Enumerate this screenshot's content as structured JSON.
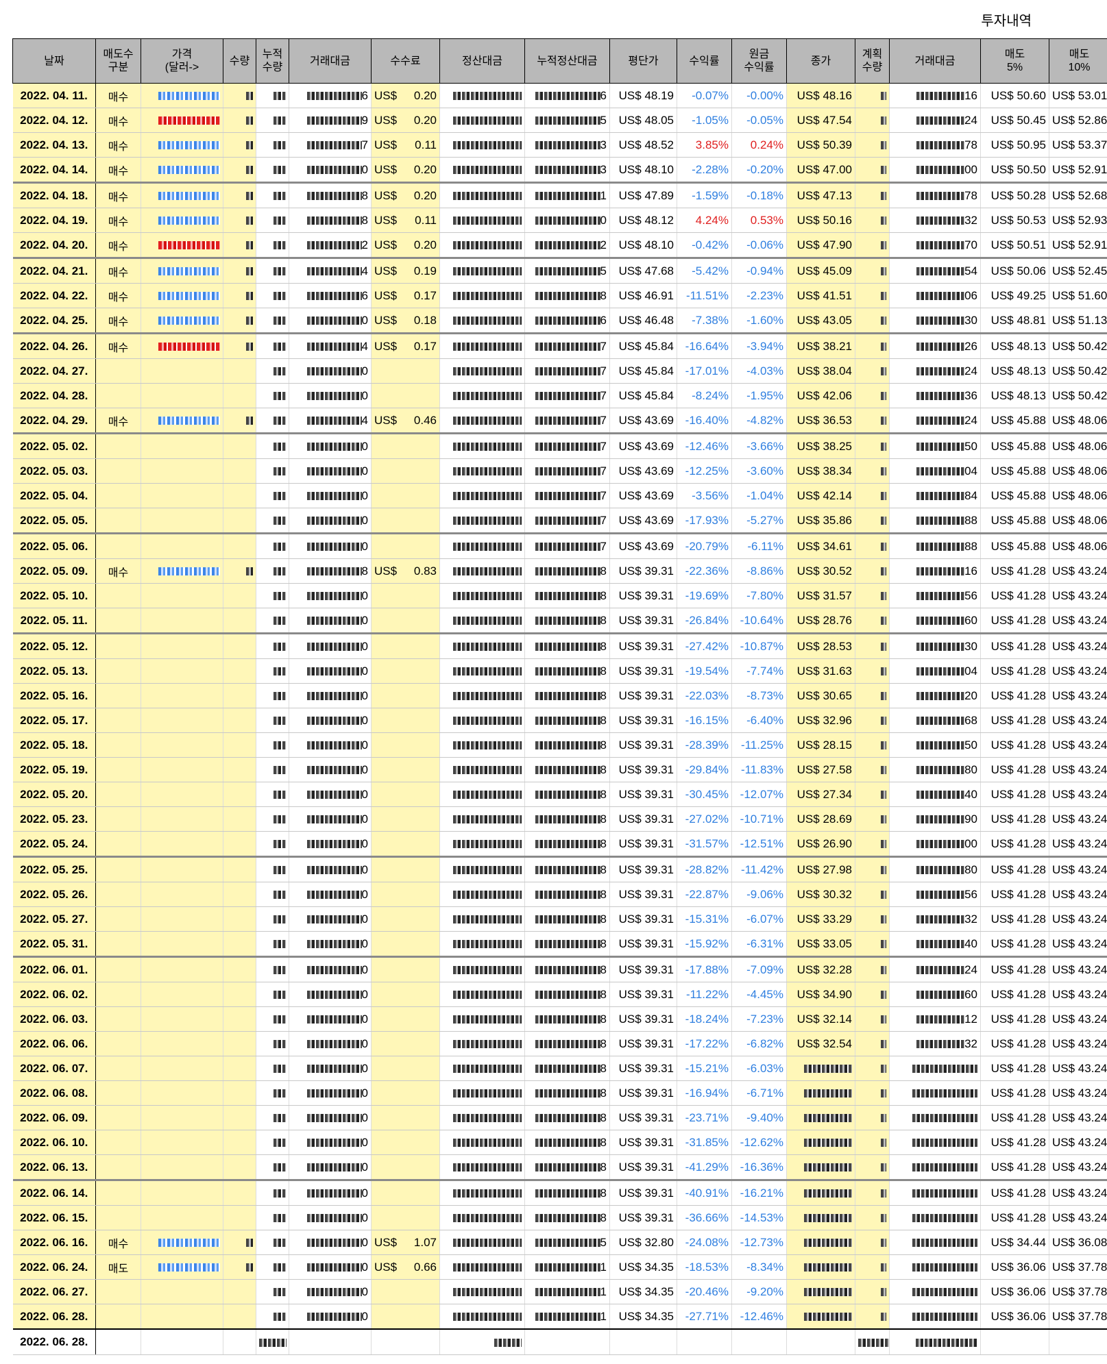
{
  "title": "투자내역",
  "headers": [
    "날짜",
    "매도수\n구분",
    "가격\n(달러->",
    "수량",
    "누적\n수량",
    "거래대금",
    "수수료",
    "정산대금",
    "누적정산대금",
    "평단가",
    "수익률",
    "원금\n수익률",
    "종가",
    "계획\n수량",
    "거래대금",
    "매도\n5%",
    "매도\n10%"
  ],
  "rows": [
    {
      "date": "2022. 04. 11.",
      "kind": "매수",
      "price_style": "blue",
      "fee": "0.20",
      "amt_tail": "6",
      "cum_tail": "6",
      "avg": "US$ 48.19",
      "ret": "-0.07%",
      "pret": "-0.00%",
      "close": "US$ 48.16",
      "amt2_tail": "16",
      "s5": "US$ 50.60",
      "s10": "US$ 53.01"
    },
    {
      "date": "2022. 04. 12.",
      "kind": "매수",
      "price_style": "red",
      "fee": "0.20",
      "amt_tail": "9",
      "cum_tail": "5",
      "avg": "US$ 48.05",
      "ret": "-1.05%",
      "pret": "-0.05%",
      "close": "US$ 47.54",
      "amt2_tail": "24",
      "s5": "US$ 50.45",
      "s10": "US$ 52.86"
    },
    {
      "date": "2022. 04. 13.",
      "kind": "매수",
      "price_style": "blue",
      "fee": "0.11",
      "amt_tail": "7",
      "cum_tail": "3",
      "avg": "US$ 48.52",
      "ret": "3.85%",
      "pret": "0.24%",
      "close": "US$ 50.39",
      "amt2_tail": "78",
      "s5": "US$ 50.95",
      "s10": "US$ 53.37"
    },
    {
      "date": "2022. 04. 14.",
      "kind": "매수",
      "price_style": "blue",
      "fee": "0.20",
      "amt_tail": "0",
      "cum_tail": "3",
      "avg": "US$ 48.10",
      "ret": "-2.28%",
      "pret": "-0.20%",
      "close": "US$ 47.00",
      "amt2_tail": "00",
      "s5": "US$ 50.50",
      "s10": "US$ 52.91"
    },
    {
      "date": "2022. 04. 18.",
      "kind": "매수",
      "price_style": "blue",
      "fee": "0.20",
      "amt_tail": "8",
      "cum_tail": "1",
      "avg": "US$ 47.89",
      "ret": "-1.59%",
      "pret": "-0.18%",
      "close": "US$ 47.13",
      "amt2_tail": "78",
      "s5": "US$ 50.28",
      "s10": "US$ 52.68",
      "sep": true
    },
    {
      "date": "2022. 04. 19.",
      "kind": "매수",
      "price_style": "blue",
      "fee": "0.11",
      "amt_tail": "8",
      "cum_tail": "0",
      "avg": "US$ 48.12",
      "ret": "4.24%",
      "pret": "0.53%",
      "close": "US$ 50.16",
      "amt2_tail": "32",
      "s5": "US$ 50.53",
      "s10": "US$ 52.93"
    },
    {
      "date": "2022. 04. 20.",
      "kind": "매수",
      "price_style": "red",
      "fee": "0.20",
      "amt_tail": "2",
      "cum_tail": "2",
      "avg": "US$ 48.10",
      "ret": "-0.42%",
      "pret": "-0.06%",
      "close": "US$ 47.90",
      "amt2_tail": "70",
      "s5": "US$ 50.51",
      "s10": "US$ 52.91"
    },
    {
      "date": "2022. 04. 21.",
      "kind": "매수",
      "price_style": "blue",
      "fee": "0.19",
      "amt_tail": "4",
      "cum_tail": "5",
      "avg": "US$ 47.68",
      "ret": "-5.42%",
      "pret": "-0.94%",
      "close": "US$ 45.09",
      "amt2_tail": "54",
      "s5": "US$ 50.06",
      "s10": "US$ 52.45",
      "sep": true
    },
    {
      "date": "2022. 04. 22.",
      "kind": "매수",
      "price_style": "blue",
      "fee": "0.17",
      "amt_tail": "6",
      "cum_tail": "8",
      "avg": "US$ 46.91",
      "ret": "-11.51%",
      "pret": "-2.23%",
      "close": "US$ 41.51",
      "amt2_tail": "06",
      "s5": "US$ 49.25",
      "s10": "US$ 51.60"
    },
    {
      "date": "2022. 04. 25.",
      "kind": "매수",
      "price_style": "blue",
      "fee": "0.18",
      "amt_tail": "0",
      "cum_tail": "6",
      "avg": "US$ 46.48",
      "ret": "-7.38%",
      "pret": "-1.60%",
      "close": "US$ 43.05",
      "amt2_tail": "30",
      "s5": "US$ 48.81",
      "s10": "US$ 51.13"
    },
    {
      "date": "2022. 04. 26.",
      "kind": "매수",
      "price_style": "red",
      "fee": "0.17",
      "amt_tail": "4",
      "cum_tail": "7",
      "avg": "US$ 45.84",
      "ret": "-16.64%",
      "pret": "-3.94%",
      "close": "US$ 38.21",
      "amt2_tail": "26",
      "s5": "US$ 48.13",
      "s10": "US$ 50.42",
      "sep": true
    },
    {
      "date": "2022. 04. 27.",
      "kind": "",
      "price_style": "",
      "fee": "",
      "amt_tail": "0",
      "cum_tail": "7",
      "avg": "US$ 45.84",
      "ret": "-17.01%",
      "pret": "-4.03%",
      "close": "US$ 38.04",
      "amt2_tail": "24",
      "s5": "US$ 48.13",
      "s10": "US$ 50.42"
    },
    {
      "date": "2022. 04. 28.",
      "kind": "",
      "price_style": "",
      "fee": "",
      "amt_tail": "0",
      "cum_tail": "7",
      "avg": "US$ 45.84",
      "ret": "-8.24%",
      "pret": "-1.95%",
      "close": "US$ 42.06",
      "amt2_tail": "36",
      "s5": "US$ 48.13",
      "s10": "US$ 50.42"
    },
    {
      "date": "2022. 04. 29.",
      "kind": "매수",
      "price_style": "blue",
      "fee": "0.46",
      "amt_tail": "4",
      "cum_tail": "7",
      "avg": "US$ 43.69",
      "ret": "-16.40%",
      "pret": "-4.82%",
      "close": "US$ 36.53",
      "amt2_tail": "24",
      "s5": "US$ 45.88",
      "s10": "US$ 48.06"
    },
    {
      "date": "2022. 05. 02.",
      "kind": "",
      "price_style": "",
      "fee": "",
      "amt_tail": "0",
      "cum_tail": "7",
      "avg": "US$ 43.69",
      "ret": "-12.46%",
      "pret": "-3.66%",
      "close": "US$ 38.25",
      "amt2_tail": "50",
      "s5": "US$ 45.88",
      "s10": "US$ 48.06",
      "sep": true
    },
    {
      "date": "2022. 05. 03.",
      "kind": "",
      "price_style": "",
      "fee": "",
      "amt_tail": "0",
      "cum_tail": "7",
      "avg": "US$ 43.69",
      "ret": "-12.25%",
      "pret": "-3.60%",
      "close": "US$ 38.34",
      "amt2_tail": "04",
      "s5": "US$ 45.88",
      "s10": "US$ 48.06"
    },
    {
      "date": "2022. 05. 04.",
      "kind": "",
      "price_style": "",
      "fee": "",
      "amt_tail": "0",
      "cum_tail": "7",
      "avg": "US$ 43.69",
      "ret": "-3.56%",
      "pret": "-1.04%",
      "close": "US$ 42.14",
      "amt2_tail": "84",
      "s5": "US$ 45.88",
      "s10": "US$ 48.06"
    },
    {
      "date": "2022. 05. 05.",
      "kind": "",
      "price_style": "",
      "fee": "",
      "amt_tail": "0",
      "cum_tail": "7",
      "avg": "US$ 43.69",
      "ret": "-17.93%",
      "pret": "-5.27%",
      "close": "US$ 35.86",
      "amt2_tail": "88",
      "s5": "US$ 45.88",
      "s10": "US$ 48.06"
    },
    {
      "date": "2022. 05. 06.",
      "kind": "",
      "price_style": "",
      "fee": "",
      "amt_tail": "0",
      "cum_tail": "7",
      "avg": "US$ 43.69",
      "ret": "-20.79%",
      "pret": "-6.11%",
      "close": "US$ 34.61",
      "amt2_tail": "88",
      "s5": "US$ 45.88",
      "s10": "US$ 48.06",
      "sep": true
    },
    {
      "date": "2022. 05. 09.",
      "kind": "매수",
      "price_style": "blue",
      "fee": "0.83",
      "amt_tail": "8",
      "cum_tail": "8",
      "avg": "US$ 39.31",
      "ret": "-22.36%",
      "pret": "-8.86%",
      "close": "US$ 30.52",
      "amt2_tail": "16",
      "s5": "US$ 41.28",
      "s10": "US$ 43.24"
    },
    {
      "date": "2022. 05. 10.",
      "kind": "",
      "price_style": "",
      "fee": "",
      "amt_tail": "0",
      "cum_tail": "8",
      "avg": "US$ 39.31",
      "ret": "-19.69%",
      "pret": "-7.80%",
      "close": "US$ 31.57",
      "amt2_tail": "56",
      "s5": "US$ 41.28",
      "s10": "US$ 43.24"
    },
    {
      "date": "2022. 05. 11.",
      "kind": "",
      "price_style": "",
      "fee": "",
      "amt_tail": "0",
      "cum_tail": "8",
      "avg": "US$ 39.31",
      "ret": "-26.84%",
      "pret": "-10.64%",
      "close": "US$ 28.76",
      "amt2_tail": "60",
      "s5": "US$ 41.28",
      "s10": "US$ 43.24"
    },
    {
      "date": "2022. 05. 12.",
      "kind": "",
      "price_style": "",
      "fee": "",
      "amt_tail": "0",
      "cum_tail": "8",
      "avg": "US$ 39.31",
      "ret": "-27.42%",
      "pret": "-10.87%",
      "close": "US$ 28.53",
      "amt2_tail": "30",
      "s5": "US$ 41.28",
      "s10": "US$ 43.24",
      "sep": true
    },
    {
      "date": "2022. 05. 13.",
      "kind": "",
      "price_style": "",
      "fee": "",
      "amt_tail": "0",
      "cum_tail": "8",
      "avg": "US$ 39.31",
      "ret": "-19.54%",
      "pret": "-7.74%",
      "close": "US$ 31.63",
      "amt2_tail": "04",
      "s5": "US$ 41.28",
      "s10": "US$ 43.24"
    },
    {
      "date": "2022. 05. 16.",
      "kind": "",
      "price_style": "",
      "fee": "",
      "amt_tail": "0",
      "cum_tail": "8",
      "avg": "US$ 39.31",
      "ret": "-22.03%",
      "pret": "-8.73%",
      "close": "US$ 30.65",
      "amt2_tail": "20",
      "s5": "US$ 41.28",
      "s10": "US$ 43.24"
    },
    {
      "date": "2022. 05. 17.",
      "kind": "",
      "price_style": "",
      "fee": "",
      "amt_tail": "0",
      "cum_tail": "8",
      "avg": "US$ 39.31",
      "ret": "-16.15%",
      "pret": "-6.40%",
      "close": "US$ 32.96",
      "amt2_tail": "68",
      "s5": "US$ 41.28",
      "s10": "US$ 43.24"
    },
    {
      "date": "2022. 05. 18.",
      "kind": "",
      "price_style": "",
      "fee": "",
      "amt_tail": "0",
      "cum_tail": "8",
      "avg": "US$ 39.31",
      "ret": "-28.39%",
      "pret": "-11.25%",
      "close": "US$ 28.15",
      "amt2_tail": "50",
      "s5": "US$ 41.28",
      "s10": "US$ 43.24"
    },
    {
      "date": "2022. 05. 19.",
      "kind": "",
      "price_style": "",
      "fee": "",
      "amt_tail": "0",
      "cum_tail": "8",
      "avg": "US$ 39.31",
      "ret": "-29.84%",
      "pret": "-11.83%",
      "close": "US$ 27.58",
      "amt2_tail": "80",
      "s5": "US$ 41.28",
      "s10": "US$ 43.24"
    },
    {
      "date": "2022. 05. 20.",
      "kind": "",
      "price_style": "",
      "fee": "",
      "amt_tail": "0",
      "cum_tail": "8",
      "avg": "US$ 39.31",
      "ret": "-30.45%",
      "pret": "-12.07%",
      "close": "US$ 27.34",
      "amt2_tail": "40",
      "s5": "US$ 41.28",
      "s10": "US$ 43.24"
    },
    {
      "date": "2022. 05. 23.",
      "kind": "",
      "price_style": "",
      "fee": "",
      "amt_tail": "0",
      "cum_tail": "8",
      "avg": "US$ 39.31",
      "ret": "-27.02%",
      "pret": "-10.71%",
      "close": "US$ 28.69",
      "amt2_tail": "90",
      "s5": "US$ 41.28",
      "s10": "US$ 43.24"
    },
    {
      "date": "2022. 05. 24.",
      "kind": "",
      "price_style": "",
      "fee": "",
      "amt_tail": "0",
      "cum_tail": "8",
      "avg": "US$ 39.31",
      "ret": "-31.57%",
      "pret": "-12.51%",
      "close": "US$ 26.90",
      "amt2_tail": "00",
      "s5": "US$ 41.28",
      "s10": "US$ 43.24"
    },
    {
      "date": "2022. 05. 25.",
      "kind": "",
      "price_style": "",
      "fee": "",
      "amt_tail": "0",
      "cum_tail": "8",
      "avg": "US$ 39.31",
      "ret": "-28.82%",
      "pret": "-11.42%",
      "close": "US$ 27.98",
      "amt2_tail": "80",
      "s5": "US$ 41.28",
      "s10": "US$ 43.24",
      "sep": true
    },
    {
      "date": "2022. 05. 26.",
      "kind": "",
      "price_style": "",
      "fee": "",
      "amt_tail": "0",
      "cum_tail": "8",
      "avg": "US$ 39.31",
      "ret": "-22.87%",
      "pret": "-9.06%",
      "close": "US$ 30.32",
      "amt2_tail": "56",
      "s5": "US$ 41.28",
      "s10": "US$ 43.24"
    },
    {
      "date": "2022. 05. 27.",
      "kind": "",
      "price_style": "",
      "fee": "",
      "amt_tail": "0",
      "cum_tail": "8",
      "avg": "US$ 39.31",
      "ret": "-15.31%",
      "pret": "-6.07%",
      "close": "US$ 33.29",
      "amt2_tail": "32",
      "s5": "US$ 41.28",
      "s10": "US$ 43.24"
    },
    {
      "date": "2022. 05. 31.",
      "kind": "",
      "price_style": "",
      "fee": "",
      "amt_tail": "0",
      "cum_tail": "8",
      "avg": "US$ 39.31",
      "ret": "-15.92%",
      "pret": "-6.31%",
      "close": "US$ 33.05",
      "amt2_tail": "40",
      "s5": "US$ 41.28",
      "s10": "US$ 43.24"
    },
    {
      "date": "2022. 06. 01.",
      "kind": "",
      "price_style": "",
      "fee": "",
      "amt_tail": "0",
      "cum_tail": "8",
      "avg": "US$ 39.31",
      "ret": "-17.88%",
      "pret": "-7.09%",
      "close": "US$ 32.28",
      "amt2_tail": "24",
      "s5": "US$ 41.28",
      "s10": "US$ 43.24",
      "sep": true
    },
    {
      "date": "2022. 06. 02.",
      "kind": "",
      "price_style": "",
      "fee": "",
      "amt_tail": "0",
      "cum_tail": "8",
      "avg": "US$ 39.31",
      "ret": "-11.22%",
      "pret": "-4.45%",
      "close": "US$ 34.90",
      "amt2_tail": "60",
      "s5": "US$ 41.28",
      "s10": "US$ 43.24"
    },
    {
      "date": "2022. 06. 03.",
      "kind": "",
      "price_style": "",
      "fee": "",
      "amt_tail": "0",
      "cum_tail": "8",
      "avg": "US$ 39.31",
      "ret": "-18.24%",
      "pret": "-7.23%",
      "close": "US$ 32.14",
      "amt2_tail": "12",
      "s5": "US$ 41.28",
      "s10": "US$ 43.24"
    },
    {
      "date": "2022. 06. 06.",
      "kind": "",
      "price_style": "",
      "fee": "",
      "amt_tail": "0",
      "cum_tail": "8",
      "avg": "US$ 39.31",
      "ret": "-17.22%",
      "pret": "-6.82%",
      "close": "US$ 32.54",
      "amt2_tail": "32",
      "s5": "US$ 41.28",
      "s10": "US$ 43.24"
    },
    {
      "date": "2022. 06. 07.",
      "kind": "",
      "price_style": "",
      "fee": "",
      "amt_tail": "0",
      "cum_tail": "8",
      "avg": "US$ 39.31",
      "ret": "-15.21%",
      "pret": "-6.03%",
      "close": "",
      "amt2_tail": "",
      "s5": "US$ 41.28",
      "s10": "US$ 43.24"
    },
    {
      "date": "2022. 06. 08.",
      "kind": "",
      "price_style": "",
      "fee": "",
      "amt_tail": "0",
      "cum_tail": "8",
      "avg": "US$ 39.31",
      "ret": "-16.94%",
      "pret": "-6.71%",
      "close": "",
      "amt2_tail": "",
      "s5": "US$ 41.28",
      "s10": "US$ 43.24"
    },
    {
      "date": "2022. 06. 09.",
      "kind": "",
      "price_style": "",
      "fee": "",
      "amt_tail": "0",
      "cum_tail": "8",
      "avg": "US$ 39.31",
      "ret": "-23.71%",
      "pret": "-9.40%",
      "close": "",
      "amt2_tail": "",
      "s5": "US$ 41.28",
      "s10": "US$ 43.24"
    },
    {
      "date": "2022. 06. 10.",
      "kind": "",
      "price_style": "",
      "fee": "",
      "amt_tail": "0",
      "cum_tail": "8",
      "avg": "US$ 39.31",
      "ret": "-31.85%",
      "pret": "-12.62%",
      "close": "",
      "amt2_tail": "",
      "s5": "US$ 41.28",
      "s10": "US$ 43.24"
    },
    {
      "date": "2022. 06. 13.",
      "kind": "",
      "price_style": "",
      "fee": "",
      "amt_tail": "0",
      "cum_tail": "8",
      "avg": "US$ 39.31",
      "ret": "-41.29%",
      "pret": "-16.36%",
      "close": "",
      "amt2_tail": "",
      "s5": "US$ 41.28",
      "s10": "US$ 43.24"
    },
    {
      "date": "2022. 06. 14.",
      "kind": "",
      "price_style": "",
      "fee": "",
      "amt_tail": "0",
      "cum_tail": "8",
      "avg": "US$ 39.31",
      "ret": "-40.91%",
      "pret": "-16.21%",
      "close": "",
      "amt2_tail": "",
      "s5": "US$ 41.28",
      "s10": "US$ 43.24",
      "sep": true
    },
    {
      "date": "2022. 06. 15.",
      "kind": "",
      "price_style": "",
      "fee": "",
      "amt_tail": "0",
      "cum_tail": "8",
      "avg": "US$ 39.31",
      "ret": "-36.66%",
      "pret": "-14.53%",
      "close": "",
      "amt2_tail": "",
      "s5": "US$ 41.28",
      "s10": "US$ 43.24"
    },
    {
      "date": "2022. 06. 16.",
      "kind": "매수",
      "price_style": "blue",
      "fee": "1.07",
      "amt_tail": "0",
      "cum_tail": "5",
      "avg": "US$ 32.80",
      "ret": "-24.08%",
      "pret": "-12.73%",
      "close": "",
      "amt2_tail": "",
      "s5": "US$ 34.44",
      "s10": "US$ 36.08"
    },
    {
      "date": "2022. 06. 24.",
      "kind": "매도",
      "price_style": "blue",
      "fee": "0.66",
      "amt_tail": "0",
      "cum_tail": "1",
      "avg": "US$ 34.35",
      "ret": "-18.53%",
      "pret": "-8.34%",
      "close": "",
      "amt2_tail": "",
      "s5": "US$ 36.06",
      "s10": "US$ 37.78"
    },
    {
      "date": "2022. 06. 27.",
      "kind": "",
      "price_style": "",
      "fee": "",
      "amt_tail": "0",
      "cum_tail": "1",
      "avg": "US$ 34.35",
      "ret": "-20.46%",
      "pret": "-9.20%",
      "close": "",
      "amt2_tail": "",
      "s5": "US$ 36.06",
      "s10": "US$ 37.78"
    },
    {
      "date": "2022. 06. 28.",
      "kind": "",
      "price_style": "",
      "fee": "",
      "amt_tail": "0",
      "cum_tail": "1",
      "avg": "US$ 34.35",
      "ret": "-27.71%",
      "pret": "-12.46%",
      "close": "",
      "amt2_tail": "",
      "s5": "US$ 36.06",
      "s10": "US$ 37.78"
    }
  ],
  "total": {
    "date": "2022. 06. 28."
  },
  "colors": {
    "header_bg": "#b9b9b9",
    "highlight": "#fff7b8",
    "negative": "#2f7fe0",
    "positive": "#e02020"
  }
}
